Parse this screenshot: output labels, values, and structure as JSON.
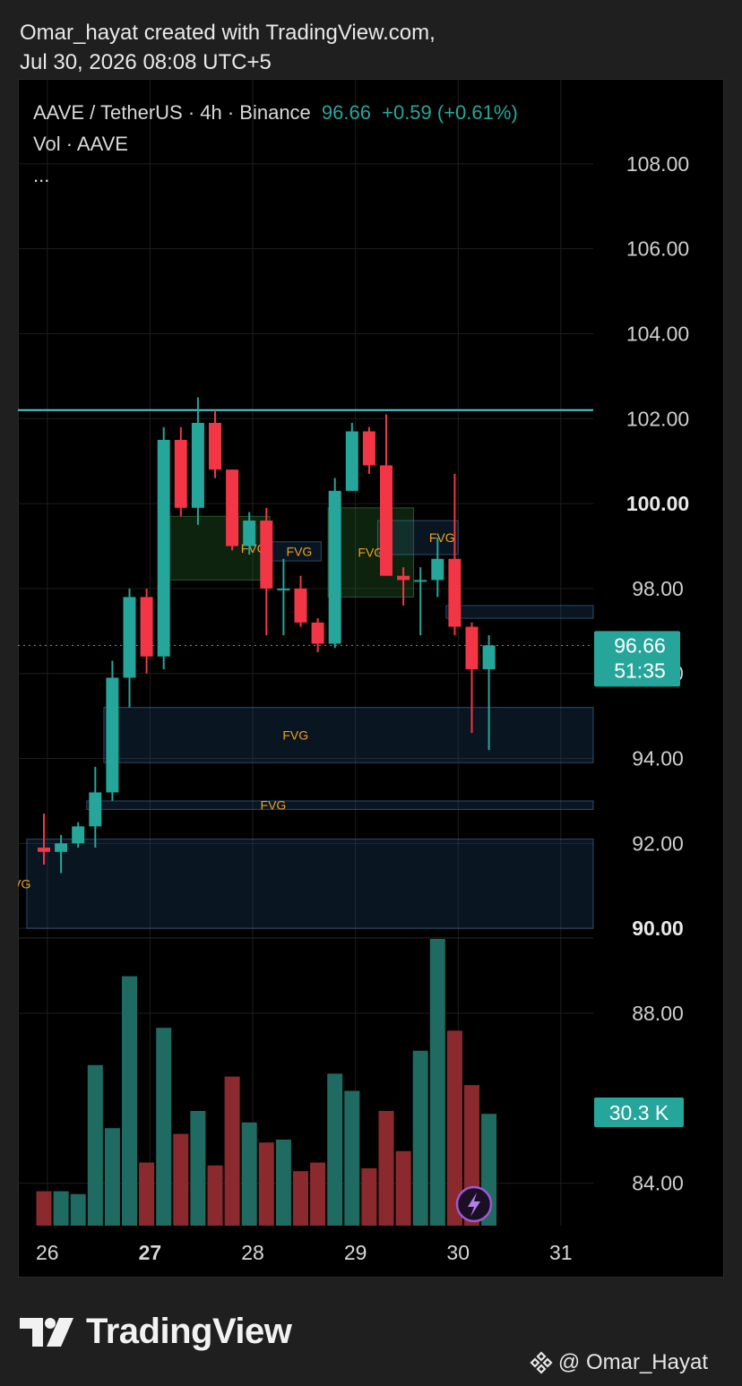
{
  "header": {
    "line1": "Omar_hayat created with TradingView.com,",
    "line2": "Jul 30, 2026 08:08 UTC+5"
  },
  "legend": {
    "symbol": "AAVE / TetherUS · 4h · Binance",
    "price": "96.66",
    "change": "+0.59 (+0.61%)",
    "volume_label": "Vol · AAVE",
    "more": "..."
  },
  "footer": {
    "brand": "TradingView",
    "credit": "@ Omar_Hayat"
  },
  "colors": {
    "up": "#26a69a",
    "down": "#f23645",
    "fvg_text": "#f0a020",
    "resistance_line": "#4dd0d6"
  },
  "chart_data": {
    "type": "candlestick",
    "timeframe": "4h",
    "ylim": [
      83,
      110
    ],
    "y_ticks": [
      "108.00",
      "106.00",
      "104.00",
      "102.00",
      "100.00",
      "98.00",
      "96.00",
      "94.00",
      "92.00",
      "90.00",
      "88.00",
      "84.00"
    ],
    "y_tick_values": [
      108,
      106,
      104,
      102,
      100,
      98,
      96,
      94,
      92,
      90,
      88,
      84
    ],
    "bold_ticks": [
      "100.00",
      "90.00"
    ],
    "x_ticks": [
      {
        "label": "26",
        "index": 0.2
      },
      {
        "label": "27",
        "index": 6.2
      },
      {
        "label": "28",
        "index": 12.2
      },
      {
        "label": "29",
        "index": 18.2
      },
      {
        "label": "30",
        "index": 24.2
      },
      {
        "label": "31",
        "index": 30.2
      }
    ],
    "current_price": {
      "value": 96.66,
      "label": "96.66",
      "countdown": "51:35"
    },
    "volume_badge": "30.3 K",
    "resistance_level": 102.2,
    "candles": [
      {
        "o": 91.9,
        "h": 92.7,
        "l": 91.5,
        "c": 91.8
      },
      {
        "o": 91.8,
        "h": 92.2,
        "l": 91.3,
        "c": 92.0
      },
      {
        "o": 92.0,
        "h": 92.5,
        "l": 91.9,
        "c": 92.4
      },
      {
        "o": 92.4,
        "h": 93.8,
        "l": 91.9,
        "c": 93.2
      },
      {
        "o": 93.2,
        "h": 96.3,
        "l": 93.0,
        "c": 95.9
      },
      {
        "o": 95.9,
        "h": 98.0,
        "l": 95.2,
        "c": 97.8
      },
      {
        "o": 97.8,
        "h": 98.0,
        "l": 96.0,
        "c": 96.4
      },
      {
        "o": 96.4,
        "h": 101.8,
        "l": 96.1,
        "c": 101.5
      },
      {
        "o": 101.5,
        "h": 101.8,
        "l": 99.7,
        "c": 99.9
      },
      {
        "o": 99.9,
        "h": 102.5,
        "l": 99.5,
        "c": 101.9
      },
      {
        "o": 101.9,
        "h": 102.2,
        "l": 100.6,
        "c": 100.8
      },
      {
        "o": 100.8,
        "h": 100.8,
        "l": 98.9,
        "c": 99.0
      },
      {
        "o": 99.0,
        "h": 99.8,
        "l": 98.8,
        "c": 99.6
      },
      {
        "o": 99.6,
        "h": 99.9,
        "l": 96.9,
        "c": 98.0
      },
      {
        "o": 98.0,
        "h": 98.7,
        "l": 96.9,
        "c": 98.0
      },
      {
        "o": 98.0,
        "h": 98.3,
        "l": 97.1,
        "c": 97.2
      },
      {
        "o": 97.2,
        "h": 97.3,
        "l": 96.5,
        "c": 96.7
      },
      {
        "o": 96.7,
        "h": 100.6,
        "l": 96.6,
        "c": 100.3
      },
      {
        "o": 100.3,
        "h": 101.9,
        "l": 100.3,
        "c": 101.7
      },
      {
        "o": 101.7,
        "h": 101.8,
        "l": 100.7,
        "c": 100.9
      },
      {
        "o": 100.9,
        "h": 102.1,
        "l": 98.3,
        "c": 98.3
      },
      {
        "o": 98.3,
        "h": 98.5,
        "l": 97.6,
        "c": 98.2
      },
      {
        "o": 98.2,
        "h": 98.5,
        "l": 96.9,
        "c": 98.2
      },
      {
        "o": 98.2,
        "h": 99.2,
        "l": 97.8,
        "c": 98.7
      },
      {
        "o": 98.7,
        "h": 100.7,
        "l": 96.9,
        "c": 97.1
      },
      {
        "o": 97.1,
        "h": 97.2,
        "l": 94.6,
        "c": 96.1
      },
      {
        "o": 96.1,
        "h": 96.9,
        "l": 94.2,
        "c": 96.66
      }
    ],
    "volume_max": 100,
    "volumes": [
      12,
      12,
      11,
      56,
      34,
      87,
      22,
      69,
      32,
      40,
      21,
      52,
      36,
      29,
      30,
      19,
      22,
      53,
      47,
      20,
      40,
      26,
      61,
      100,
      68,
      49,
      39
    ],
    "fvg_zones": [
      {
        "label": "FVG",
        "i1": 6.7,
        "i2": 13.2,
        "low": 98.2,
        "high": 99.7,
        "color": "green",
        "label_pos": "right"
      },
      {
        "label": "FVG",
        "i1": 12.8,
        "i2": 16.2,
        "low": 98.65,
        "high": 99.1,
        "color": "blue",
        "label_pos": "inside"
      },
      {
        "label": "FVG",
        "i1": 16.6,
        "i2": 21.6,
        "low": 97.8,
        "high": 99.9,
        "color": "green",
        "label_pos": "center"
      },
      {
        "label": "FVG",
        "i1": 19.5,
        "i2": 24.2,
        "low": 98.8,
        "high": 99.6,
        "color": "blue",
        "label_pos": "right"
      },
      {
        "label": "FVG",
        "i1": 3.5,
        "i2": 33.0,
        "low": 93.9,
        "high": 95.2,
        "color": "blue",
        "label_pos": "center"
      },
      {
        "label": "FVG",
        "i1": 2.5,
        "i2": 33.0,
        "low": 92.8,
        "high": 93.0,
        "color": "blue",
        "label_pos": "center"
      },
      {
        "label": "FVG",
        "i1": -1.0,
        "i2": 33.0,
        "low": 90.0,
        "high": 92.1,
        "color": "blue",
        "label_pos": "left"
      },
      {
        "label": "",
        "i1": 23.5,
        "i2": 33.0,
        "low": 97.3,
        "high": 97.6,
        "color": "blue",
        "label_pos": "none"
      }
    ]
  }
}
